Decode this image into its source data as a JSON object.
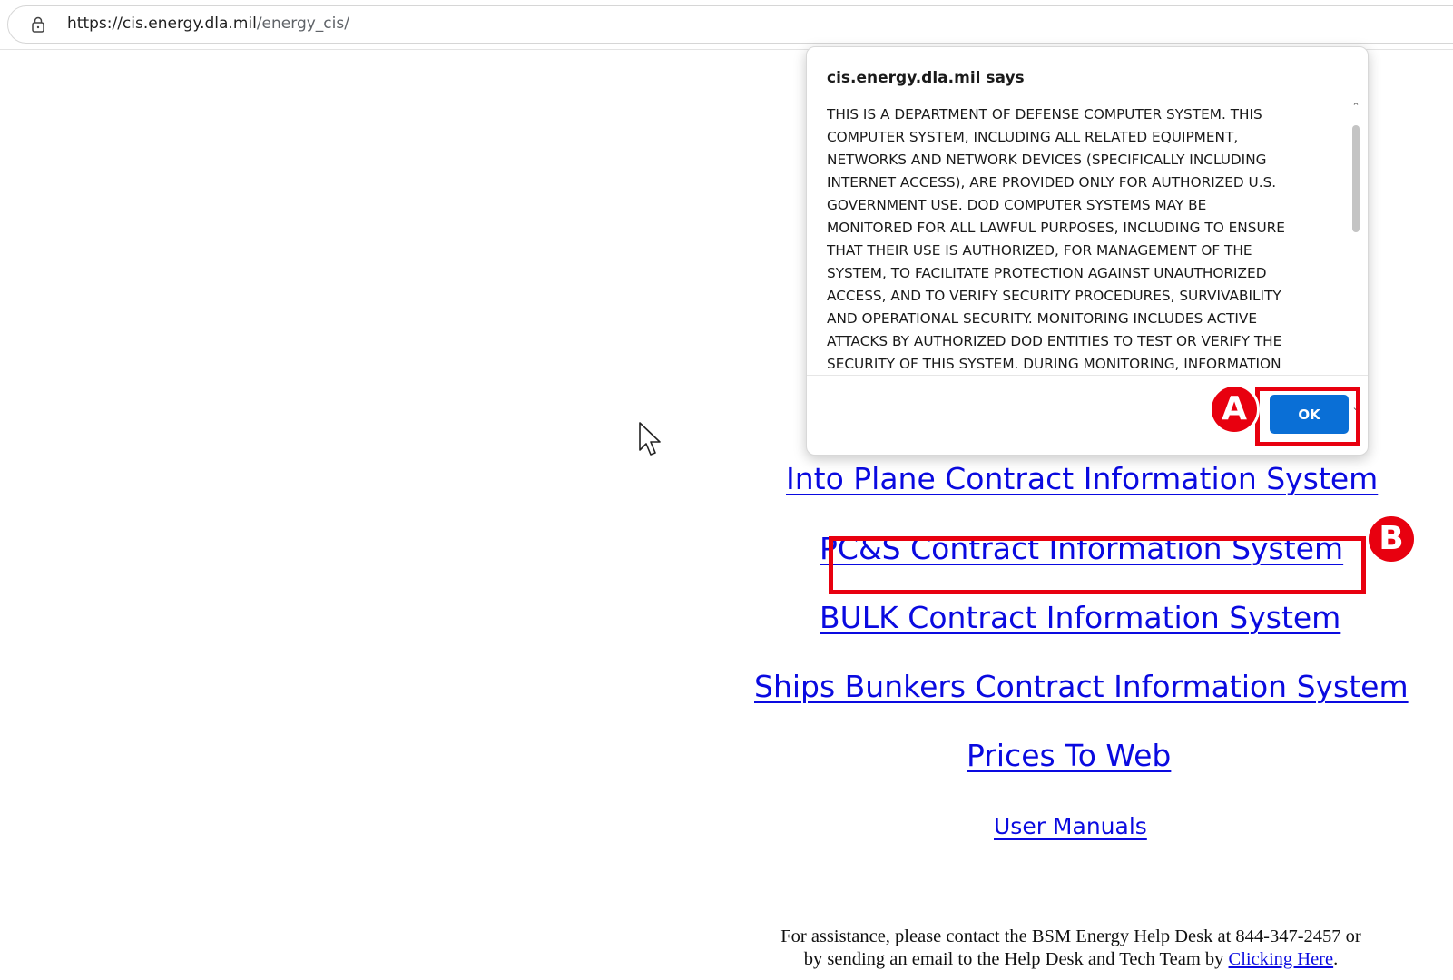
{
  "browser": {
    "url_host": "https://cis.energy.dla.mil",
    "url_path": "/energy_cis/"
  },
  "dialog": {
    "title": "cis.energy.dla.mil says",
    "lines": [
      "THIS IS A DEPARTMENT OF DEFENSE COMPUTER SYSTEM. THIS",
      "COMPUTER SYSTEM, INCLUDING ALL RELATED EQUIPMENT,",
      "NETWORKS AND NETWORK DEVICES (SPECIFICALLY INCLUDING",
      "INTERNET ACCESS), ARE PROVIDED ONLY FOR AUTHORIZED U.S.",
      "GOVERNMENT USE. DOD COMPUTER SYSTEMS MAY BE",
      "MONITORED FOR ALL LAWFUL PURPOSES, INCLUDING TO ENSURE",
      "THAT THEIR USE IS AUTHORIZED, FOR MANAGEMENT OF THE",
      "SYSTEM, TO FACILITATE PROTECTION AGAINST UNAUTHORIZED",
      "ACCESS, AND TO VERIFY SECURITY PROCEDURES, SURVIVABILITY",
      "AND OPERATIONAL SECURITY. MONITORING INCLUDES ACTIVE",
      "ATTACKS BY AUTHORIZED DOD ENTITIES TO TEST OR VERIFY THE",
      "SECURITY OF THIS SYSTEM. DURING MONITORING, INFORMATION"
    ],
    "ok_label": "OK"
  },
  "links": {
    "into_plane": "Into Plane Contract Information System",
    "pcs": "PC&S Contract Information System",
    "bulk": "BULK Contract Information System",
    "ships_bunkers": "Ships Bunkers Contract Information System",
    "prices_to_web": "Prices To Web",
    "user_manuals": "User Manuals"
  },
  "help": {
    "line1": "For assistance, please contact the BSM Energy Help Desk at 844-347-2457 or",
    "line2_prefix": "by sending an email to the Help Desk and Tech Team by ",
    "link_text": "Clicking Here",
    "line2_suffix": "."
  },
  "annotations": {
    "a_label": "A",
    "b_label": "B",
    "color": "#e8000f"
  },
  "colors": {
    "link": "#0a0ae0",
    "ok_button": "#0a6fd6"
  }
}
